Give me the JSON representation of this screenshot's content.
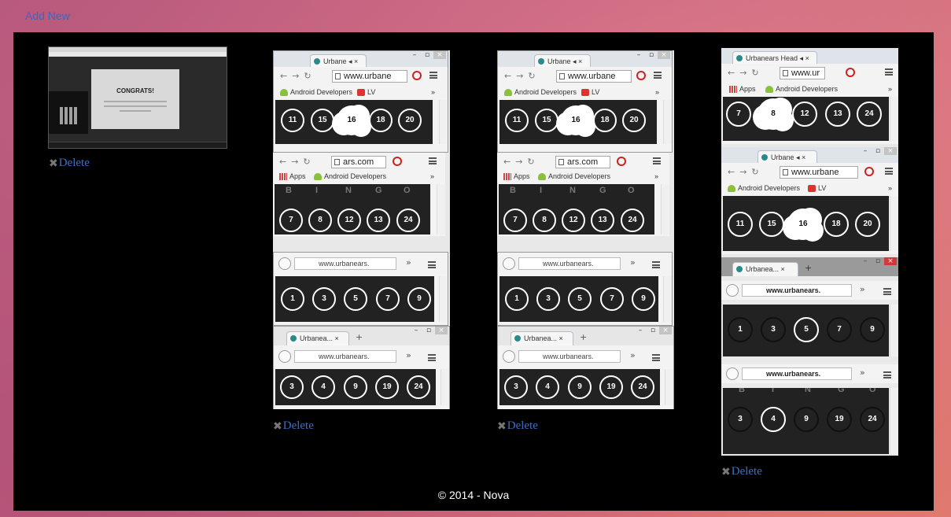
{
  "header": {
    "add_new": "Add New"
  },
  "footer": {
    "copyright": "© 2014 - Nova"
  },
  "delete_label": "Delete",
  "delete_icon": "✖",
  "shot1": {
    "modal_title": "CONGRATS!"
  },
  "tabs": {
    "urbane": "Urbane",
    "urbanea": "Urbanea...",
    "urbanears_head": "Urbanears Head"
  },
  "urls": {
    "urbane": "www.urbane",
    "ars": "ars.com",
    "ur": "www.ur",
    "ff_urbanears": "www.urbanears.",
    "ff_urbanears_bold": "www.urbanears."
  },
  "bookmarks": {
    "apps": "Apps",
    "android": "Android Developers",
    "lv": "LV",
    "more": "»"
  },
  "bingo_letters": [
    "B",
    "I",
    "N",
    "G",
    "O"
  ],
  "rows": {
    "row_a": [
      "11",
      "15",
      "16",
      "18",
      "20"
    ],
    "row_b": [
      "7",
      "8",
      "12",
      "13",
      "24"
    ],
    "row_c": [
      "1",
      "3",
      "5",
      "7",
      "9"
    ],
    "row_d": [
      "3",
      "4",
      "9",
      "19",
      "24"
    ]
  }
}
